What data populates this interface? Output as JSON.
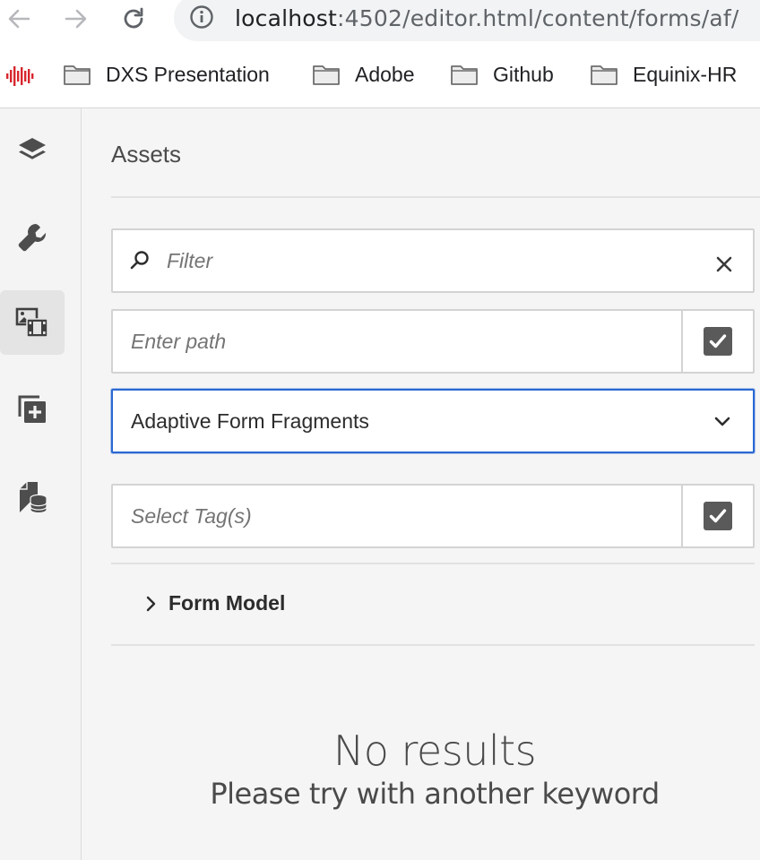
{
  "browser": {
    "url_host": "localhost",
    "url_path": ":4502/editor.html/content/forms/af/",
    "back_icon": "arrow-left-icon",
    "forward_icon": "arrow-right-icon",
    "reload_icon": "reload-icon",
    "info_icon": "info-icon"
  },
  "bookmarks": [
    {
      "label": "DXS Presentation",
      "icon": "folder-icon"
    },
    {
      "label": "Adobe",
      "icon": "folder-icon"
    },
    {
      "label": "Github",
      "icon": "folder-icon"
    },
    {
      "label": "Equinix-HR",
      "icon": "folder-icon"
    }
  ],
  "rail": {
    "items": [
      {
        "icon": "layers-icon",
        "active": false
      },
      {
        "icon": "wrench-icon",
        "active": false
      },
      {
        "icon": "assets-icon",
        "active": true
      },
      {
        "icon": "add-component-icon",
        "active": false
      },
      {
        "icon": "data-sources-icon",
        "active": false
      }
    ]
  },
  "panel": {
    "title": "Assets",
    "filter_placeholder": "Filter",
    "path_placeholder": "Enter path",
    "type_selected": "Adaptive Form Fragments",
    "tags_placeholder": "Select Tag(s)",
    "accordion_label": "Form Model",
    "empty_title": "No results",
    "empty_subtitle": "Please try with another keyword"
  },
  "colors": {
    "accent": "#2b68d2",
    "bookmark_app_icon": "#d7262d"
  }
}
